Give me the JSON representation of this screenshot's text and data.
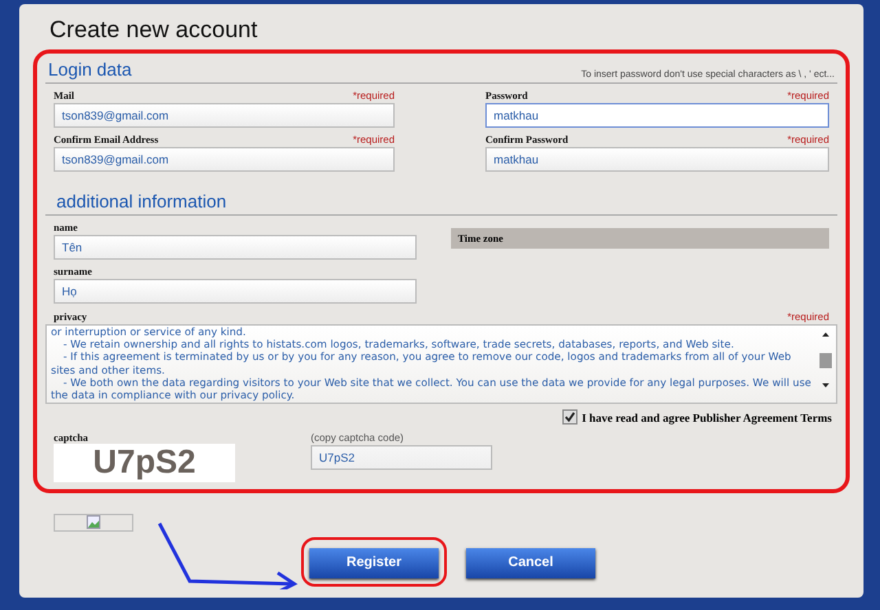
{
  "window": {
    "title": "Create new account"
  },
  "login_data": {
    "heading": "Login data",
    "note": "To insert password don't use special characters as \\ , ' ect...",
    "fields": [
      {
        "label": "Mail",
        "required_mark": "*required",
        "value": "tson839@gmail.com",
        "focused": false
      },
      {
        "label": "Password",
        "required_mark": "*required",
        "value": "matkhau",
        "focused": true
      },
      {
        "label": "Confirm Email Address",
        "required_mark": "*required",
        "value": "tson839@gmail.com",
        "focused": false
      },
      {
        "label": "Confirm Password",
        "required_mark": "*required",
        "value": "matkhau",
        "focused": false
      }
    ]
  },
  "additional_information": {
    "heading": "additional information",
    "fields": [
      {
        "label": "name",
        "value": "Tên"
      },
      {
        "label": "surname",
        "value": "Họ"
      }
    ],
    "time_zone": {
      "label": "Time zone"
    },
    "privacy": {
      "label": "privacy",
      "required_mark": "*required",
      "paragraphs": [
        "or interruption or service of any kind.",
        "- We retain ownership and all rights to histats.com logos, trademarks, software, trade secrets, databases, reports, and Web site.",
        "- If this agreement is terminated by us or by you for any reason, you agree to remove our code, logos and trademarks from all of your Web sites and other items.",
        "- We both own the data regarding visitors to your Web site that we collect. You can use the data we provide for any legal purposes. We will use the data in compliance with our privacy policy."
      ]
    },
    "agreement": {
      "label": "I have read and agree Publisher Agreement Terms",
      "checked": true
    }
  },
  "captcha": {
    "label": "captcha",
    "image_text": "U7pS2",
    "code_label": "(copy captcha code)",
    "code_value": "U7pS2"
  },
  "buttons": [
    {
      "label": "Register",
      "highlighted": true
    },
    {
      "label": "Cancel",
      "highlighted": false
    }
  ]
}
